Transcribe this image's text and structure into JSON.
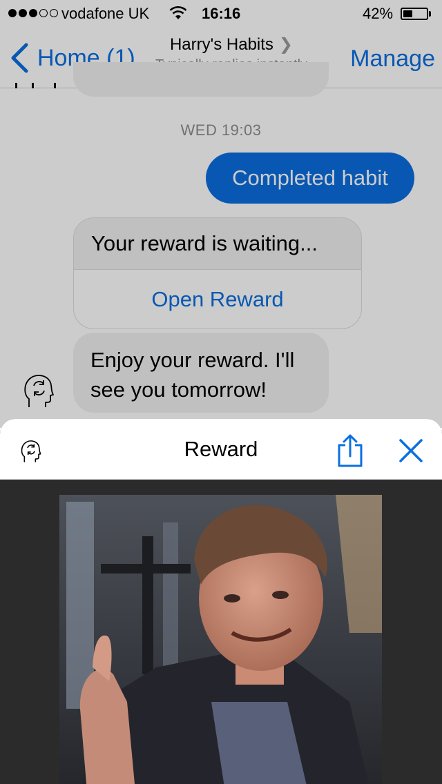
{
  "status_bar": {
    "carrier": "vodafone UK",
    "time": "16:16",
    "battery_percent": "42%",
    "battery_level": 0.42
  },
  "nav": {
    "back_label": "Home (1)",
    "title": "Harry's Habits",
    "subtitle": "Typically replies instantly",
    "manage_label": "Manage"
  },
  "conversation": {
    "timestamp": "WED 19:03",
    "outgoing_message": "Completed habit",
    "reward_card": {
      "text": "Your reward is waiting...",
      "button_label": "Open Reward"
    },
    "incoming_message": "Enjoy your reward. I'll see you tomorrow!"
  },
  "reward_sheet": {
    "title": "Reward"
  },
  "colors": {
    "accent": "#0a6fe0",
    "bubble_gray": "#f0f0f0",
    "sheet_background": "#2b2b2b"
  },
  "icons": {
    "back": "chevron-left-icon",
    "bot_avatar": "head-cycle-icon",
    "share": "share-icon",
    "close": "close-icon"
  }
}
